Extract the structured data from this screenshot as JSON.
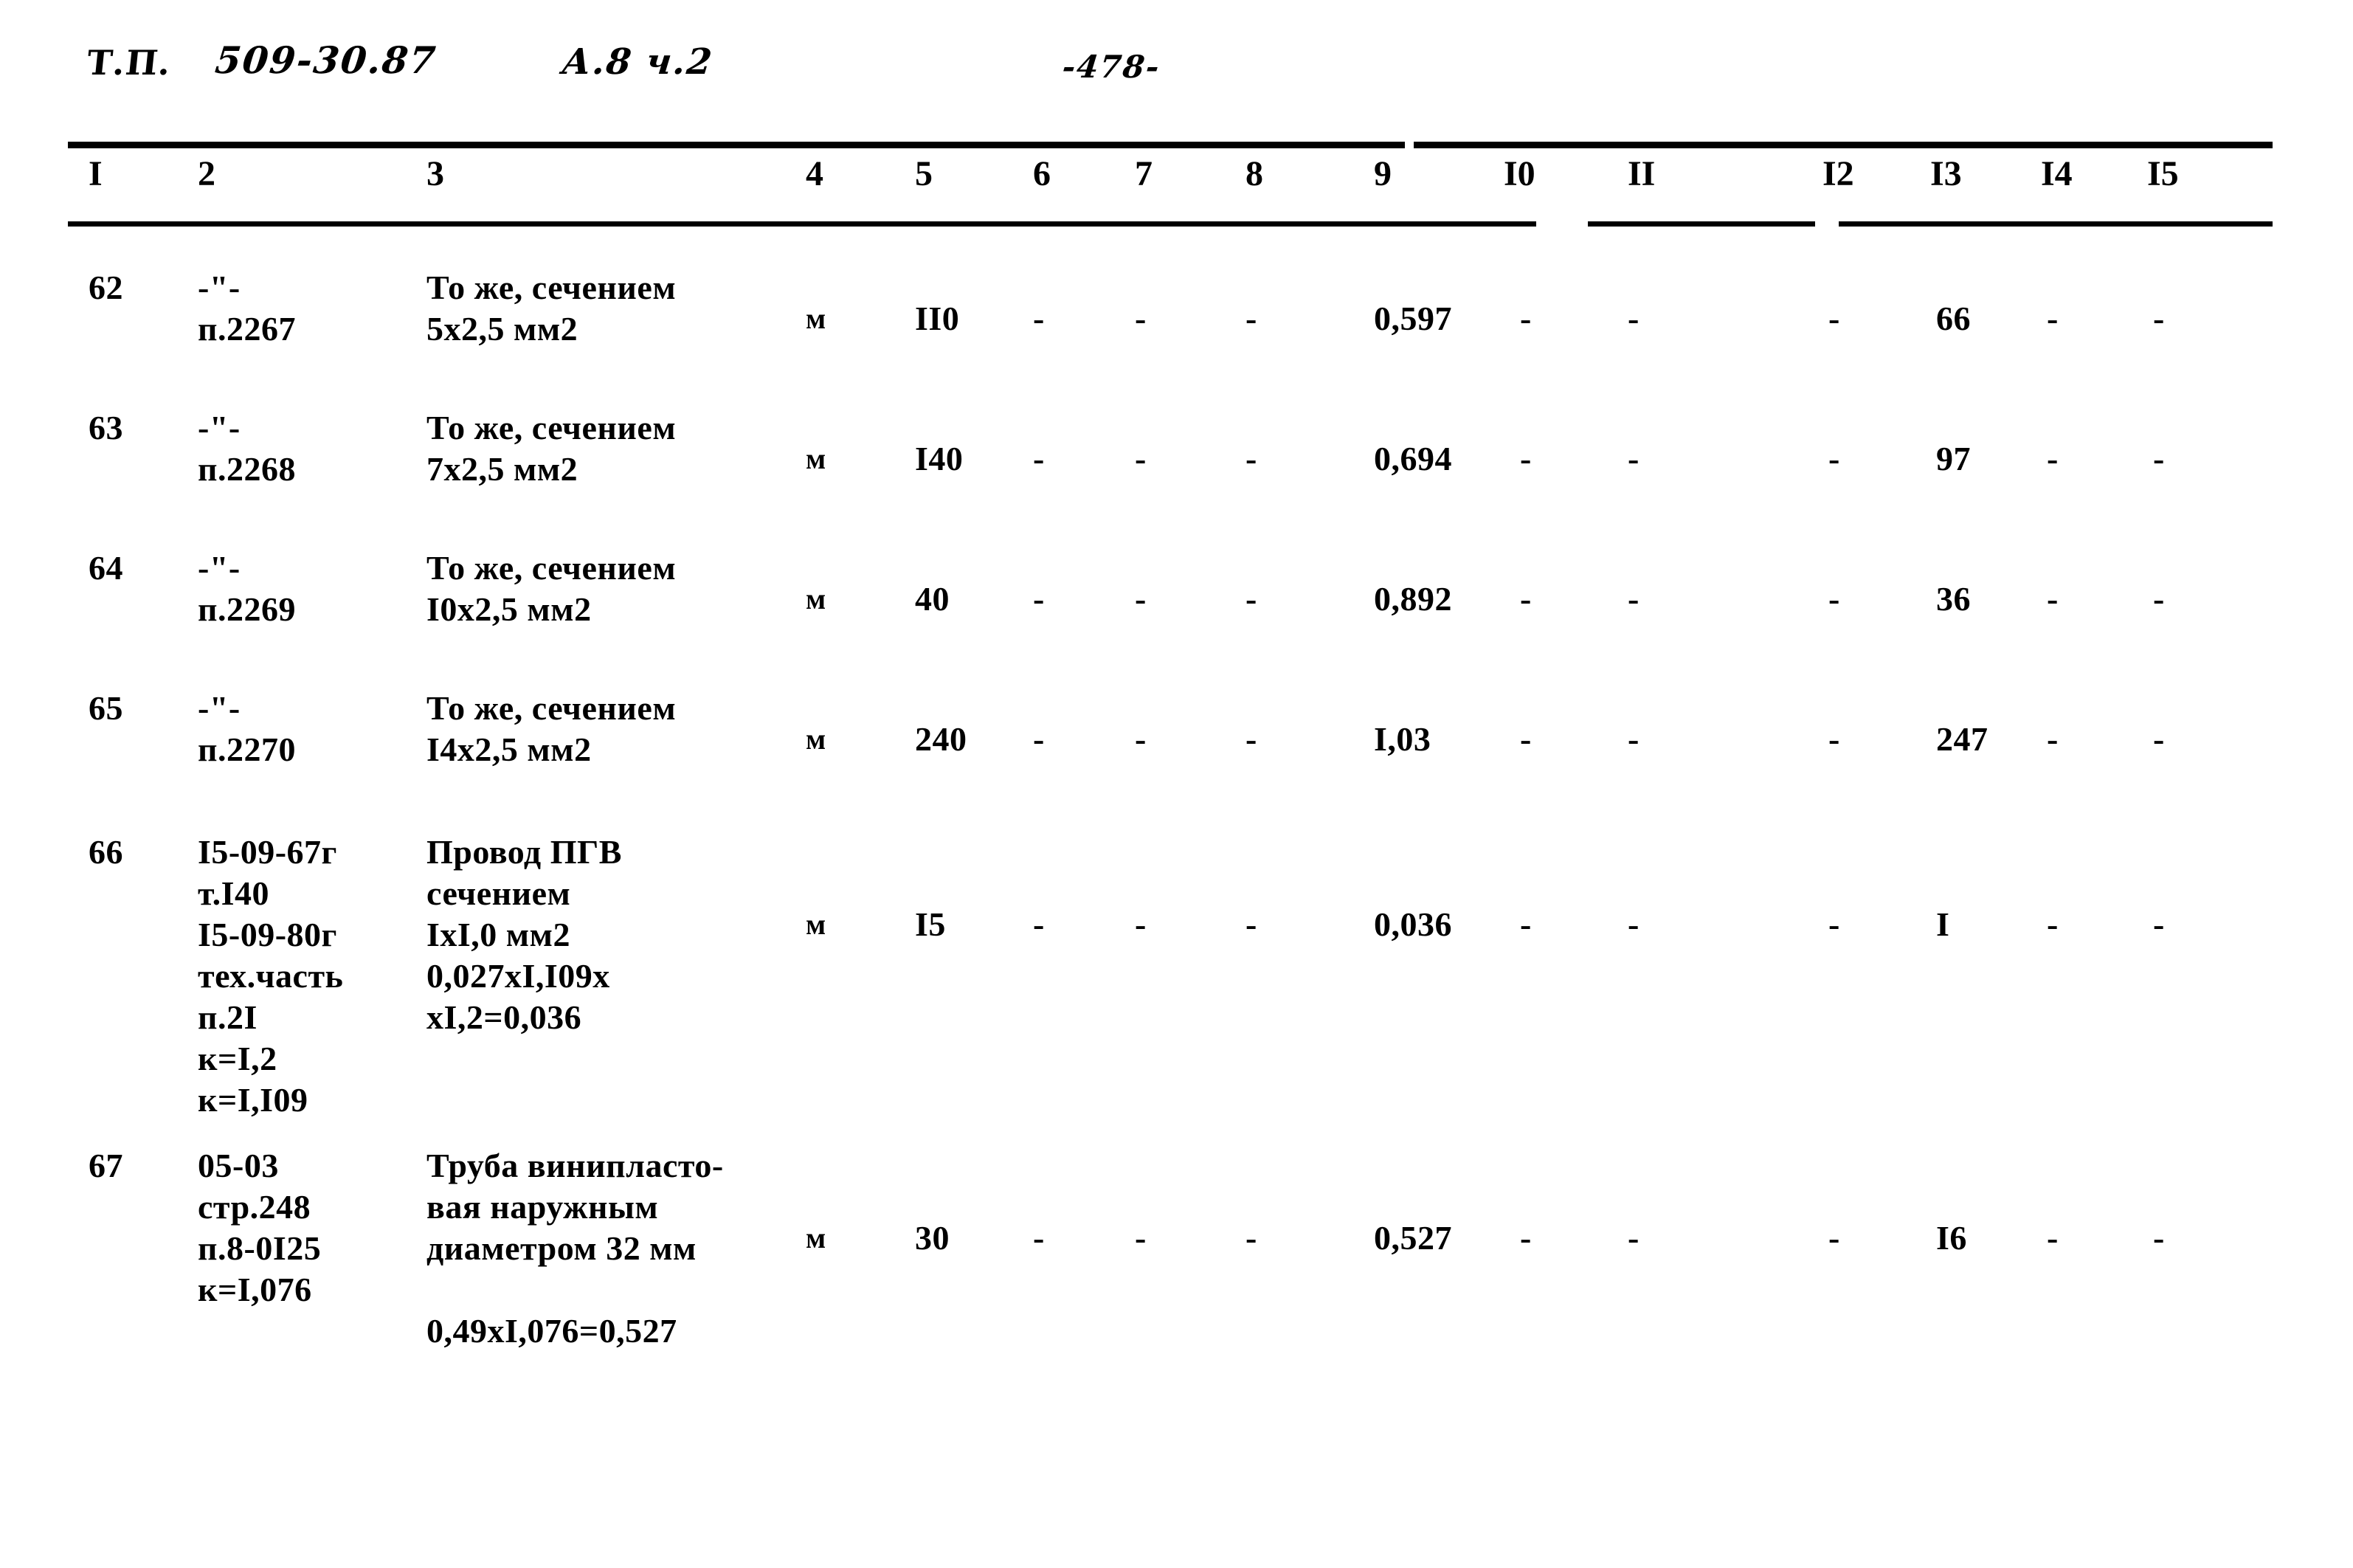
{
  "header": {
    "doc_prefix": "Т.П.",
    "doc_code": "509-30.87",
    "album": "А.8 ч.2",
    "page_number": "-478-"
  },
  "table": {
    "column_headers": [
      "I",
      "2",
      "3",
      "4",
      "5",
      "6",
      "7",
      "8",
      "9",
      "I0",
      "II",
      "I2",
      "I3",
      "I4",
      "I5"
    ],
    "column_header_left": [
      120,
      268,
      578,
      1092,
      1240,
      1400,
      1538,
      1688,
      1862,
      2038,
      2206,
      2470,
      2616,
      2766,
      2910
    ],
    "rows": [
      {
        "num": "62",
        "col2": [
          "-\"-",
          "п.2267"
        ],
        "col3": [
          "То же, сечением",
          "5х2,5 мм2"
        ],
        "col4": "м",
        "col5": "II0",
        "col6": "-",
        "col7": "-",
        "col8": "-",
        "col9": "0,597",
        "col10": "-",
        "col11": "-",
        "col12": "-",
        "col13": "66",
        "col14": "-",
        "col15": "-"
      },
      {
        "num": "63",
        "col2": [
          "-\"-",
          "п.2268"
        ],
        "col3": [
          "То же, сечением",
          "7х2,5 мм2"
        ],
        "col4": "м",
        "col5": "I40",
        "col6": "-",
        "col7": "-",
        "col8": "-",
        "col9": "0,694",
        "col10": "-",
        "col11": "-",
        "col12": "-",
        "col13": "97",
        "col14": "-",
        "col15": "-"
      },
      {
        "num": "64",
        "col2": [
          "-\"-",
          "п.2269"
        ],
        "col3": [
          "То же, сечением",
          "I0х2,5 мм2"
        ],
        "col4": "м",
        "col5": "40",
        "col6": "-",
        "col7": "-",
        "col8": "-",
        "col9": "0,892",
        "col10": "-",
        "col11": "-",
        "col12": "-",
        "col13": "36",
        "col14": "-",
        "col15": "-"
      },
      {
        "num": "65",
        "col2": [
          "-\"-",
          "п.2270"
        ],
        "col3": [
          "То же, сечением",
          "I4х2,5 мм2"
        ],
        "col4": "м",
        "col5": "240",
        "col6": "-",
        "col7": "-",
        "col8": "-",
        "col9": "I,03",
        "col10": "-",
        "col11": "-",
        "col12": "-",
        "col13": "247",
        "col14": "-",
        "col15": "-"
      },
      {
        "num": "66",
        "col2": [
          "I5-09-67г",
          "т.I40",
          "I5-09-80г",
          "тех.часть",
          "п.2I",
          "к=I,2",
          "к=I,I09"
        ],
        "col3": [
          "Провод ПГВ",
          "сечением",
          "IхI,0 мм2",
          "0,027хI,I09х",
          "хI,2=0,036"
        ],
        "col4": "м",
        "col5": "I5",
        "col6": "-",
        "col7": "-",
        "col8": "-",
        "col9": "0,036",
        "col10": "-",
        "col11": "-",
        "col12": "-",
        "col13": "I",
        "col14": "-",
        "col15": "-"
      },
      {
        "num": "67",
        "col2": [
          "05-03",
          "стр.248",
          "п.8-0I25",
          "к=I,076"
        ],
        "col3": [
          "Труба винипласто-",
          "вая наружным",
          "диаметром 32 мм",
          "",
          "0,49хI,076=0,527"
        ],
        "col4": "м",
        "col5": "30",
        "col6": "-",
        "col7": "-",
        "col8": "-",
        "col9": "0,527",
        "col10": "-",
        "col11": "-",
        "col12": "-",
        "col13": "I6",
        "col14": "-",
        "col15": "-"
      }
    ]
  }
}
